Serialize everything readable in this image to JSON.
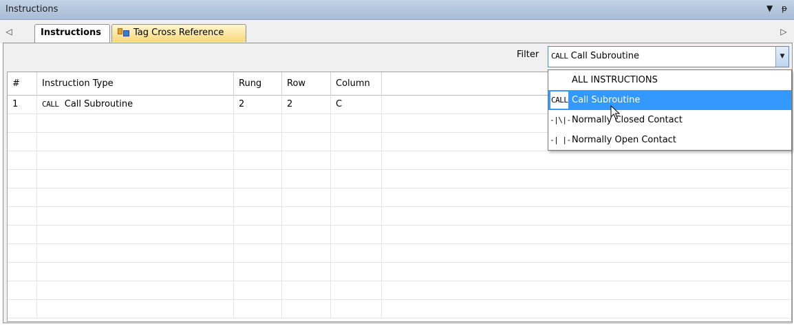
{
  "window": {
    "title": "Instructions",
    "menu_glyph": "▼",
    "pin_glyph": "ᵽ"
  },
  "tabs": {
    "scroll_left": "◁",
    "scroll_right": "▷",
    "items": [
      {
        "label": "Instructions",
        "active": true
      },
      {
        "label": "Tag Cross Reference",
        "active": false
      }
    ]
  },
  "filter": {
    "label": "Filter",
    "icon_text": "CALL",
    "value": "Call Subroutine",
    "arrow": "▼",
    "options": [
      {
        "icon": "",
        "label": "ALL INSTRUCTIONS",
        "selected": false
      },
      {
        "icon": "CALL",
        "label": "Call Subroutine",
        "selected": true
      },
      {
        "icon": "-|\\|-",
        "label": "Normally Closed Contact",
        "selected": false
      },
      {
        "icon": "-| |-",
        "label": "Normally Open Contact",
        "selected": false
      }
    ]
  },
  "table": {
    "columns": [
      "#",
      "Instruction Type",
      "Rung",
      "Row",
      "Column"
    ],
    "rows": [
      {
        "num": "1",
        "icon": "CALL",
        "type": "Call Subroutine",
        "rung": "2",
        "row": "2",
        "column": "C"
      }
    ]
  },
  "colors": {
    "title_bar": "#b6c8de",
    "selected_item": "#3399ff",
    "active_tab": "#ffffff",
    "inactive_tab": "#f6d97a"
  }
}
